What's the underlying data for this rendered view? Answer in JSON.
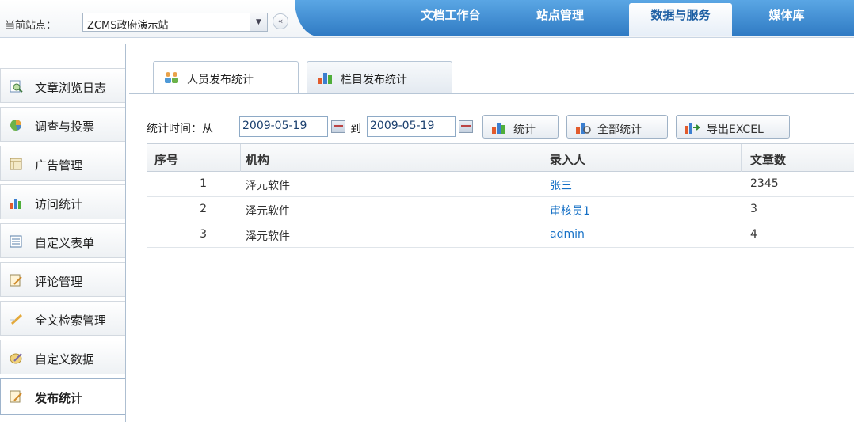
{
  "header": {
    "site_label": "当前站点：",
    "site_value": "ZCMS政府演示站",
    "nav_tabs": [
      {
        "label": "文档工作台",
        "active": false
      },
      {
        "label": "站点管理",
        "active": false
      },
      {
        "label": "数据与服务",
        "active": true
      },
      {
        "label": "媒体库",
        "active": false
      }
    ]
  },
  "sidebar": {
    "items": [
      {
        "label": "文章浏览日志",
        "icon": "search-doc-icon"
      },
      {
        "label": "调查与投票",
        "icon": "pie-icon"
      },
      {
        "label": "广告管理",
        "icon": "ad-grid-icon"
      },
      {
        "label": "访问统计",
        "icon": "bar-chart-icon"
      },
      {
        "label": "自定义表单",
        "icon": "form-icon"
      },
      {
        "label": "评论管理",
        "icon": "comment-icon"
      },
      {
        "label": "全文检索管理",
        "icon": "pencil-icon"
      },
      {
        "label": "自定义数据",
        "icon": "data-icon"
      },
      {
        "label": "发布统计",
        "icon": "publish-icon",
        "active": true
      }
    ]
  },
  "content": {
    "tabs": [
      {
        "label": "人员发布统计",
        "icon": "people-icon",
        "active": true
      },
      {
        "label": "栏目发布统计",
        "icon": "bar-chart-icon",
        "active": false
      }
    ],
    "toolbar": {
      "time_label": "统计时间：从",
      "date_from": "2009-05-19",
      "to_label": "到",
      "date_to": "2009-05-19",
      "stat_button": "统计",
      "all_stat_button": "全部统计",
      "export_button": "导出EXCEL"
    },
    "table": {
      "columns": [
        "序号",
        "机构",
        "录入人",
        "文章数"
      ],
      "rows": [
        {
          "no": "1",
          "org": "泽元软件",
          "user": "张三",
          "count": "2345"
        },
        {
          "no": "2",
          "org": "泽元软件",
          "user": "审核员1",
          "count": "3"
        },
        {
          "no": "3",
          "org": "泽元软件",
          "user": "admin",
          "count": "4"
        }
      ]
    }
  },
  "colors": {
    "nav_blue": "#2f7ac3",
    "link_blue": "#1570c6",
    "border": "#b7c6d6"
  }
}
